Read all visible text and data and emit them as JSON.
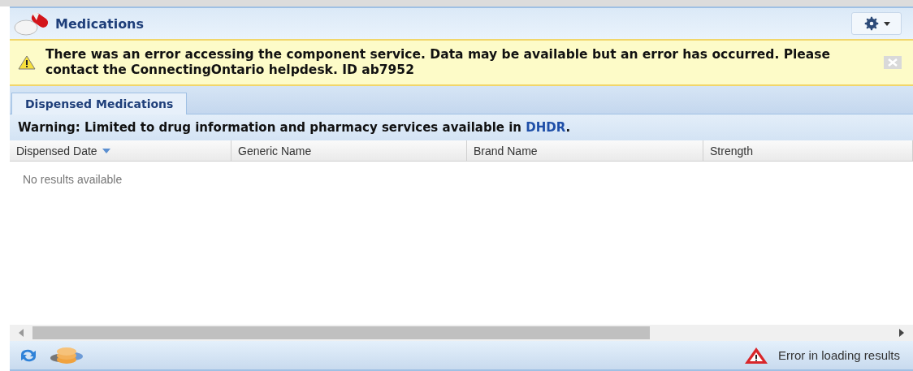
{
  "header": {
    "title": "Medications"
  },
  "alert": {
    "message": "There was an error accessing the component service. Data may be available but an error has occurred. Please contact the ConnectingOntario helpdesk. ID ab7952"
  },
  "tabs": [
    {
      "label": "Dispensed Medications",
      "selected": true
    }
  ],
  "warning": {
    "text": "Warning: Limited to drug information and pharmacy services available in ",
    "link": "DHDR",
    "suffix": "."
  },
  "table": {
    "columns": [
      {
        "label": "Dispensed Date",
        "sorted": true
      },
      {
        "label": "Generic Name",
        "sorted": false
      },
      {
        "label": "Brand Name",
        "sorted": false
      },
      {
        "label": "Strength",
        "sorted": false
      }
    ],
    "empty_message": "No results available"
  },
  "status_bar": {
    "message": "Error in loading results"
  }
}
